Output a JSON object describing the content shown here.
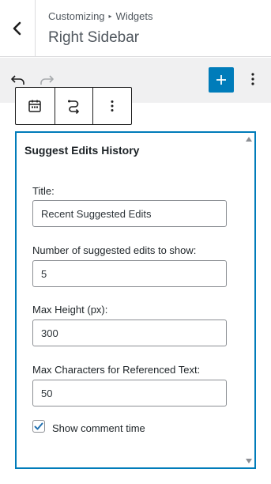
{
  "header": {
    "breadcrumb": [
      "Customizing",
      "Widgets"
    ],
    "title": "Right Sidebar"
  },
  "widget": {
    "title": "Suggest Edits History",
    "fields": [
      {
        "label": "Title:",
        "value": "Recent Suggested Edits"
      },
      {
        "label": "Number of suggested edits to show:",
        "value": "5"
      },
      {
        "label": "Max Height (px):",
        "value": "300"
      },
      {
        "label": "Max Characters for Referenced Text:",
        "value": "50"
      }
    ],
    "checkbox": {
      "label": "Show comment time",
      "checked": true
    }
  },
  "colors": {
    "accent": "#007cba",
    "toolbar_bg": "#f0f0f1",
    "text": "#1d2327",
    "muted": "#50575e"
  },
  "icons": [
    "chevron-left-icon",
    "undo-icon",
    "redo-icon",
    "plus-icon",
    "more-vertical-icon",
    "calendar-icon",
    "transform-icon",
    "triangle-up-icon",
    "triangle-down-icon",
    "check-icon"
  ]
}
